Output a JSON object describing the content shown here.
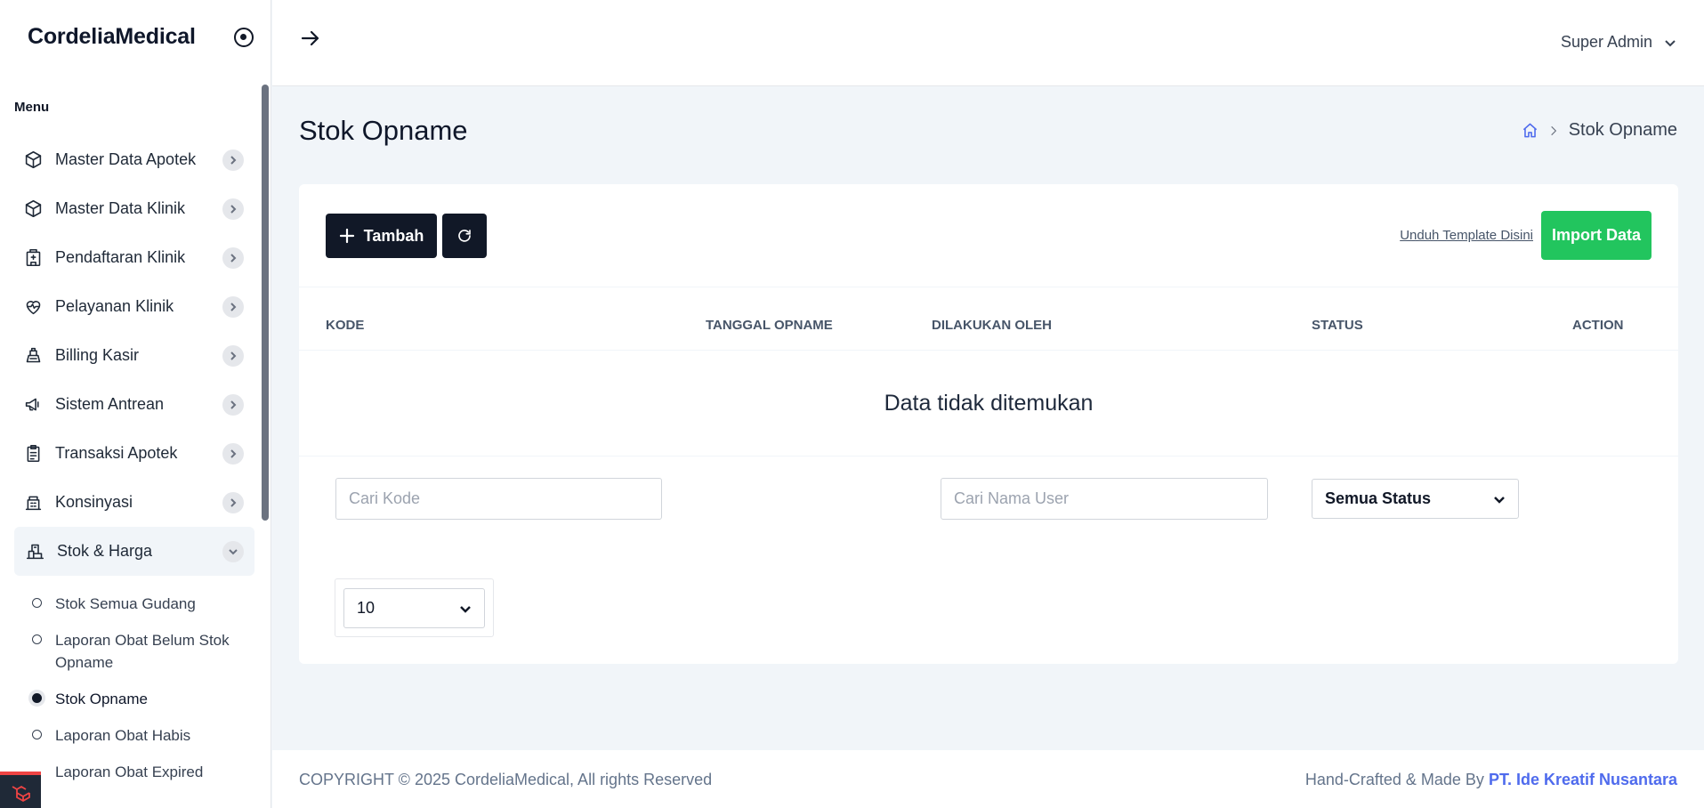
{
  "sidebar": {
    "brand": "CordeliaMedical",
    "menu_title": "Menu",
    "items": [
      {
        "label": "Master Data Apotek",
        "icon": "cube-icon"
      },
      {
        "label": "Master Data Klinik",
        "icon": "cube-icon"
      },
      {
        "label": "Pendaftaran Klinik",
        "icon": "clinic-building-icon"
      },
      {
        "label": "Pelayanan Klinik",
        "icon": "heart-pulse-icon"
      },
      {
        "label": "Billing Kasir",
        "icon": "cash-register-icon"
      },
      {
        "label": "Sistem Antrean",
        "icon": "megaphone-icon"
      },
      {
        "label": "Transaksi Apotek",
        "icon": "clipboard-icon"
      },
      {
        "label": "Konsinyasi",
        "icon": "building-icon"
      },
      {
        "label": "Stok & Harga",
        "icon": "warehouse-icon"
      }
    ],
    "sub_items": [
      {
        "label": "Stok Semua Gudang"
      },
      {
        "label": "Laporan Obat Belum Stok Opname"
      },
      {
        "label": "Stok Opname"
      },
      {
        "label": "Laporan Obat Habis"
      },
      {
        "label": "Laporan Obat Expired"
      }
    ]
  },
  "topbar": {
    "user_name": "Super Admin"
  },
  "page": {
    "title": "Stok Opname",
    "breadcrumb_current": "Stok Opname"
  },
  "toolbar": {
    "add_label": "Tambah",
    "template_link": "Unduh Template Disini",
    "import_label": "Import Data"
  },
  "table": {
    "columns": [
      "KODE",
      "TANGGAL OPNAME",
      "DILAKUKAN OLEH",
      "STATUS",
      "ACTION"
    ],
    "empty_message": "Data tidak ditemukan"
  },
  "filters": {
    "code_placeholder": "Cari Kode",
    "user_placeholder": "Cari Nama User",
    "status_value": "Semua Status",
    "per_page_value": "10"
  },
  "footer": {
    "copyright": "COPYRIGHT © 2025 CordeliaMedical, All rights Reserved",
    "crafted_by": "Hand-Crafted & Made By ",
    "company": "PT. Ide Kreatif Nusantara"
  },
  "colors": {
    "primary_dark": "#111827",
    "success": "#22c55e",
    "link_blue": "#4f6bed"
  }
}
